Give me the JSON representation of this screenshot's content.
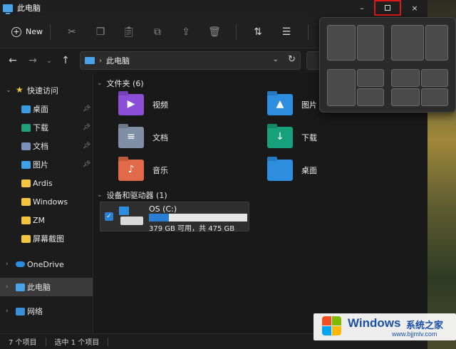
{
  "window": {
    "title": "此电脑",
    "controls": {
      "minimize": "–",
      "maximize": "□",
      "close": "×"
    }
  },
  "commandbar": {
    "new_label": "New",
    "icons": [
      "cut-icon",
      "copy-icon",
      "paste-icon",
      "rename-icon",
      "share-icon",
      "delete-icon",
      "sort-icon",
      "view-icon",
      "more-icon"
    ]
  },
  "address": {
    "path_root": "此电脑"
  },
  "sidebar": {
    "quick_access": "快速访问",
    "items": [
      {
        "label": "桌面",
        "pinned": true
      },
      {
        "label": "下载",
        "pinned": true
      },
      {
        "label": "文档",
        "pinned": true
      },
      {
        "label": "图片",
        "pinned": true
      },
      {
        "label": "Ardis",
        "pinned": false
      },
      {
        "label": "Windows",
        "pinned": false
      },
      {
        "label": "ZM",
        "pinned": false
      },
      {
        "label": "屏幕截图",
        "pinned": false
      }
    ],
    "onedrive": "OneDrive",
    "this_pc": "此电脑",
    "network": "网络"
  },
  "content": {
    "folders_header": "文件夹 (6)",
    "folders": [
      {
        "label": "视频"
      },
      {
        "label": "图片"
      },
      {
        "label": "文档"
      },
      {
        "label": "下载"
      },
      {
        "label": "音乐"
      },
      {
        "label": "桌面"
      }
    ],
    "devices_header": "设备和驱动器 (1)",
    "drive": {
      "name": "OS (C:)",
      "space": "379 GB 可用，共 475 GB",
      "used_fraction": 0.2
    }
  },
  "statusbar": {
    "items_count": "7 个项目",
    "selected": "选中 1 个项目"
  },
  "brand": {
    "name": "Windows",
    "cn": "系统之家",
    "url": "www.bjjmlv.com"
  },
  "colors": {
    "accent": "#2a7fd4",
    "maximize_highlight": "#e01818"
  }
}
